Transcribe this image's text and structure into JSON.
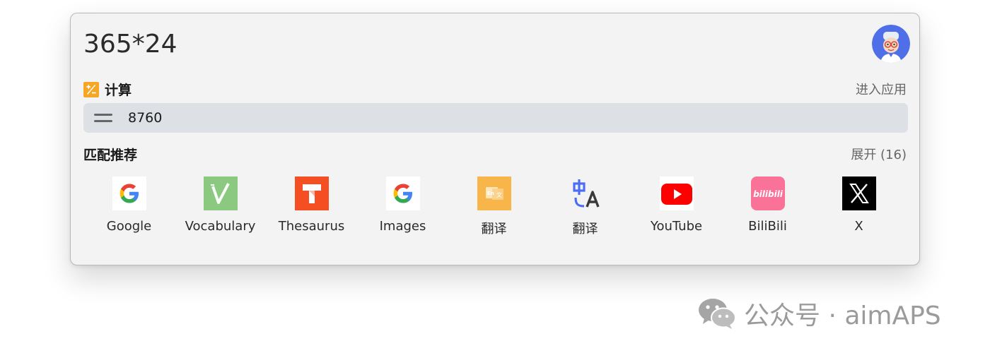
{
  "search": {
    "query": "365*24"
  },
  "calculator": {
    "title": "计算",
    "open_app_label": "进入应用",
    "result": "8760"
  },
  "recommendations": {
    "title": "匹配推荐",
    "expand_label": "展开 (16)",
    "apps": [
      {
        "label": "Google",
        "icon": "google-g-icon"
      },
      {
        "label": "Vocabulary",
        "icon": "vocabulary-check-icon"
      },
      {
        "label": "Thesaurus",
        "icon": "thesaurus-t-icon"
      },
      {
        "label": "Images",
        "icon": "google-images-icon"
      },
      {
        "label": "翻译",
        "icon": "translate-book-icon"
      },
      {
        "label": "翻译",
        "icon": "translate-zh-a-icon"
      },
      {
        "label": "YouTube",
        "icon": "youtube-icon"
      },
      {
        "label": "BiliBili",
        "icon": "bilibili-icon"
      },
      {
        "label": "X",
        "icon": "x-logo-icon"
      }
    ]
  },
  "watermark": {
    "text": "公众号 · aimAPS"
  },
  "colors": {
    "panel_bg": "#f3f3f3",
    "result_bar_bg": "#dde0e5",
    "calc_icon": "#f5a623",
    "youtube_red": "#ff0000",
    "bilibili_pink": "#fb7299",
    "thesaurus_orange": "#f44e22",
    "vocabulary_green": "#8bc981",
    "translate_orange": "#f7b54a"
  }
}
